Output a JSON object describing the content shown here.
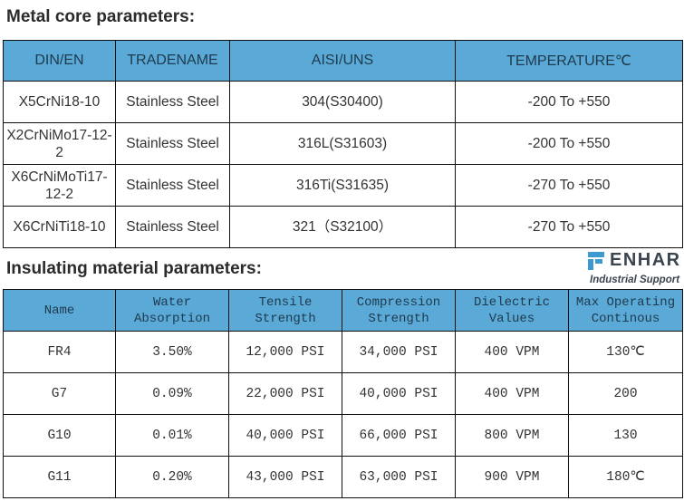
{
  "metal_core": {
    "title": "Metal core parameters:",
    "headers": [
      "DIN/EN",
      "TRADENAME",
      "AISI/UNS",
      "TEMPERATURE℃"
    ],
    "rows": [
      [
        "X5CrNi18-10",
        "Stainless Steel",
        "304(S30400)",
        "-200 To +550"
      ],
      [
        "X2CrNiMo17-12-2",
        "Stainless Steel",
        "316L(S31603)",
        "-200 To +550"
      ],
      [
        "X6CrNiMoTi17-12-2",
        "Stainless Steel",
        "316Ti(S31635)",
        "-270 To +550"
      ],
      [
        "X6CrNiTi18-10",
        "Stainless Steel",
        "321（S32100）",
        "-270 To +550"
      ]
    ]
  },
  "insulating": {
    "title": "Insulating material parameters:",
    "headers": [
      [
        "Name",
        ""
      ],
      [
        "Water",
        "Absorption"
      ],
      [
        "Tensile",
        "Strength"
      ],
      [
        "Compression",
        "Strength"
      ],
      [
        "Dielectric",
        "Values"
      ],
      [
        "Max Operating",
        "Continous"
      ]
    ],
    "rows": [
      [
        "FR4",
        "3.50%",
        "12,000 PSI",
        "34,000 PSI",
        "400 VPM",
        "130℃"
      ],
      [
        "G7",
        "0.09%",
        "22,000 PSI",
        "40,000 PSI",
        "400 VPM",
        "200"
      ],
      [
        "G10",
        "0.01%",
        "40,000 PSI",
        "66,000 PSI",
        "800 VPM",
        "130"
      ],
      [
        "G11",
        "0.20%",
        "43,000 PSI",
        "63,000 PSI",
        "900 VPM",
        "180℃"
      ]
    ]
  },
  "logo": {
    "name": "ENHAR",
    "tagline": "Industrial Support",
    "accent": "#3d9ad1"
  },
  "colors": {
    "header_bg": "#5aa9d6",
    "border": "#111111"
  }
}
